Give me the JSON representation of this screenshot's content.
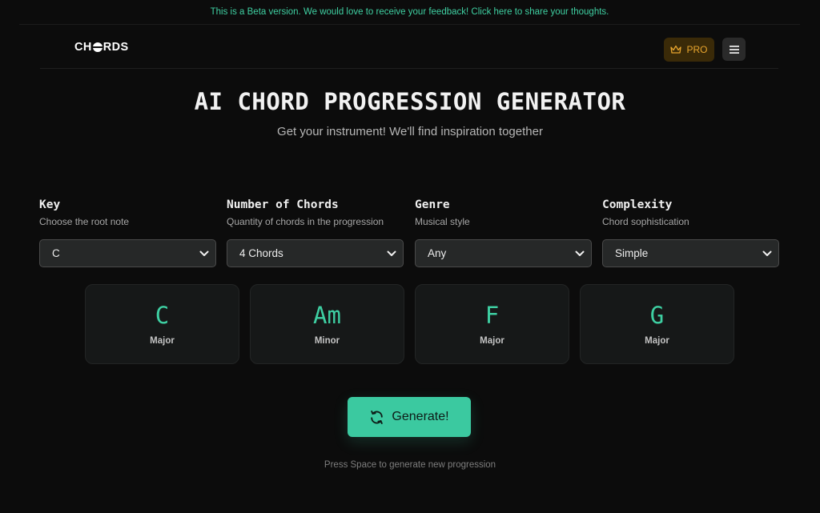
{
  "banner": {
    "text": "This is a Beta version. We would love to receive your feedback! Click here to share your thoughts."
  },
  "header": {
    "logo": {
      "part1": "CH",
      "part2": "RDS"
    },
    "pro_label": "PRO",
    "pro_icon": "crown-icon",
    "menu_icon": "hamburger-menu-icon"
  },
  "hero": {
    "title": "AI CHORD PROGRESSION GENERATOR",
    "subtitle": "Get your instrument! We'll find inspiration together"
  },
  "controls": [
    {
      "label": "Key",
      "hint": "Choose the root note",
      "value": "C"
    },
    {
      "label": "Number of Chords",
      "hint": "Quantity of chords in the progression",
      "value": "4 Chords"
    },
    {
      "label": "Genre",
      "hint": "Musical style",
      "value": "Any"
    },
    {
      "label": "Complexity",
      "hint": "Chord sophistication",
      "value": "Simple"
    }
  ],
  "chords": [
    {
      "root": "C",
      "quality": "Major"
    },
    {
      "root": "Am",
      "quality": "Minor"
    },
    {
      "root": "F",
      "quality": "Major"
    },
    {
      "root": "G",
      "quality": "Major"
    }
  ],
  "generate": {
    "label": "Generate!",
    "icon": "refresh-icon"
  },
  "footer_hint": "Press Space to generate new progression",
  "colors": {
    "accent": "#3bc9a0",
    "background": "#0c0c0c",
    "pro_text": "#e8a52e",
    "pro_bg": "#3a2a08"
  }
}
